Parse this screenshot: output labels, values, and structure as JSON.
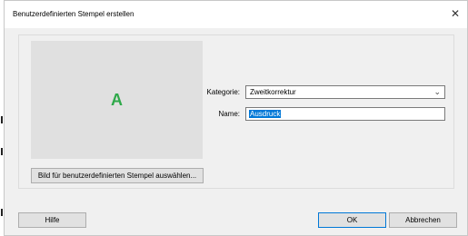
{
  "dialog": {
    "title": "Benutzerdefinierten Stempel erstellen",
    "close_glyph": "✕"
  },
  "preview": {
    "letter": "A",
    "select_button_label": "Bild für benutzerdefinierten Stempel auswählen..."
  },
  "form": {
    "category_label": "Kategorie:",
    "category_value": "Zweitkorrektur",
    "name_label": "Name:",
    "name_value": "Ausdruck"
  },
  "footer": {
    "help_label": "Hilfe",
    "ok_label": "OK",
    "cancel_label": "Abbrechen"
  },
  "colors": {
    "accent": "#0078d7",
    "preview_letter": "#2fa94a"
  }
}
